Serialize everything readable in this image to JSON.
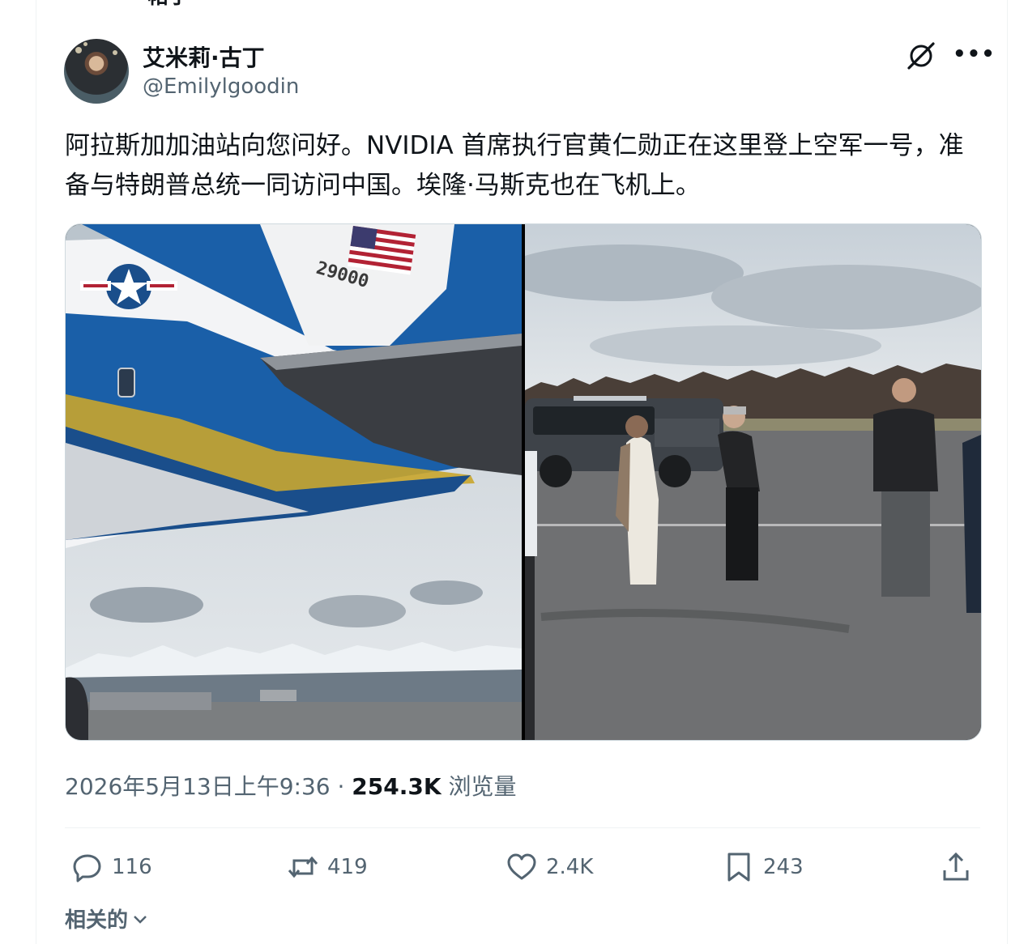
{
  "header": {
    "title": "帖子"
  },
  "author": {
    "name": "艾米莉·古丁",
    "handle": "@Emilylgoodin"
  },
  "icons": {
    "grok": "grok-icon",
    "more": "more-icon"
  },
  "tweet": {
    "text": "阿拉斯加加油站向您问好。NVIDIA 首席执行官黄仁勋正在这里登上空军一号，准备与特朗普总统一同访问中国。埃隆·马斯克也在飞机上。",
    "tail_number": "29000"
  },
  "meta": {
    "timestamp": "2026年5月13日上午9:36",
    "separator": " · ",
    "views_count": "254.3K",
    "views_label": "浏览量"
  },
  "actions": {
    "replies": "116",
    "reposts": "419",
    "likes": "2.4K",
    "bookmarks": "243"
  },
  "related": {
    "label": "相关的"
  },
  "colors": {
    "text": "#0f1419",
    "muted": "#536471",
    "border": "#eff3f4"
  }
}
